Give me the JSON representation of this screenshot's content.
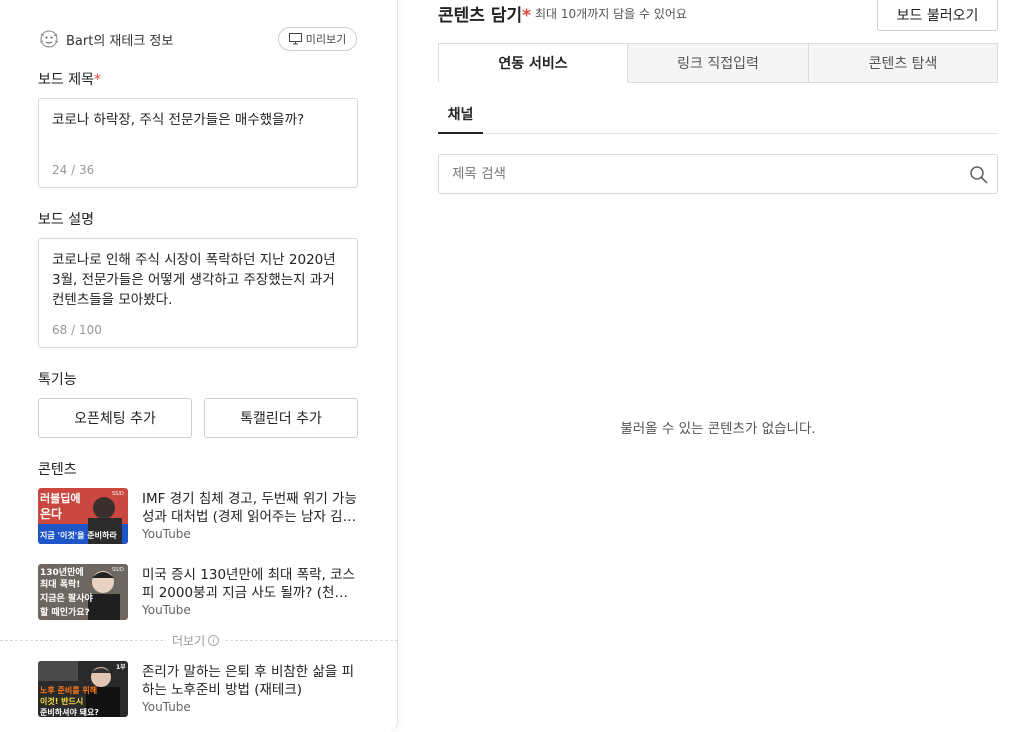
{
  "profile": {
    "name": "Bart의 재테크 정보",
    "preview_label": "미리보기"
  },
  "board_title": {
    "label": "보드 제목",
    "required_mark": "*",
    "value": "코로나 하락장, 주식 전문가들은 매수했을까?",
    "count": "24 / 36"
  },
  "board_desc": {
    "label": "보드 설명",
    "value": "코로나로 인해 주식 시장이 폭락하던 지난 2020년 3월, 전문가들은 어떻게 생각하고 주장했는지 과거 컨텐츠들을 모아봤다.",
    "count": "68 / 100"
  },
  "features": {
    "label": "톡기능",
    "open_chat_label": "오픈체팅 추가",
    "talk_calendar_label": "톡캘린더 추가"
  },
  "contents": {
    "label": "콘텐츠",
    "more_label": "더보기",
    "items": [
      {
        "title": "IMF 경기 침체 경고, 두번째 위기 가능성과 대처법 (경제 읽어주는 남자 김광석)",
        "source": "YouTube",
        "thumb_lines": [
          "러블딥에",
          "온다",
          "지금 '이것'을 준비하라"
        ],
        "thumb_badge": "SS/D"
      },
      {
        "title": "미국 증시 130년만에 최대 폭락, 코스피 2000붕괴 지금 사도 될까? (천영록)",
        "source": "YouTube",
        "thumb_lines": [
          "130년만에",
          "최대 폭락!",
          "지금은 팔사야",
          "할 때인가요?"
        ],
        "thumb_badge": "SS/D"
      },
      {
        "title": "존리가 말하는 은퇴 후 비참한 삶을 피하는 노후준비 방법 (재테크)",
        "source": "YouTube",
        "thumb_lines": [
          "노후 준비를 위해",
          "이것! 반드시",
          "준비하셔야 돼요?"
        ],
        "thumb_badge": "1부"
      }
    ]
  },
  "right": {
    "title": "콘텐츠 담기",
    "required_mark": "*",
    "hint": "최대 10개까지 담을 수 있어요",
    "load_board_label": "보드 불러오기",
    "tabs": [
      {
        "label": "연동 서비스",
        "active": true
      },
      {
        "label": "링크 직접입력",
        "active": false
      },
      {
        "label": "콘텐츠 탐색",
        "active": false
      }
    ],
    "subtab_label": "채널",
    "search_placeholder": "제목 검색",
    "empty_message": "불러올 수 있는 콘텐츠가 없습니다."
  },
  "colors": {
    "required": "#e0473c",
    "thumb1_bg": "#c9473e",
    "thumb2_bg": "#6d6761",
    "thumb3_bg": "#2a2a2a"
  }
}
